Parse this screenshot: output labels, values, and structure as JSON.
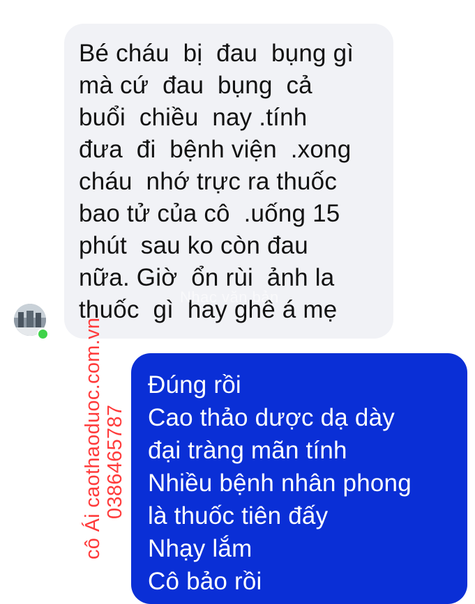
{
  "incoming_message": {
    "lines": [
      "Bé cháu  bị  đau  bụng gì",
      "mà cứ  đau  bụng  cả",
      "buổi  chiều  nay .tính",
      "đưa  đi  bệnh viện  .xong",
      "cháu  nhớ trực ra thuốc",
      "bao tử của cô  .uống 15",
      "phút  sau ko còn đau",
      "nữa. Giờ  ổn rùi  ảnh la",
      "thuốc  gì  hay ghê á mẹ"
    ]
  },
  "outgoing_message": {
    "lines": [
      "Đúng rồi",
      "Cao thảo dược dạ dày",
      "đại tràng mãn tính",
      "Nhiều bệnh nhân phong",
      "là thuốc tiên đấy",
      "Nhạy lắm",
      "Cô bảo rồi"
    ]
  },
  "watermark": {
    "line1": "cô Ái caothaoduoc.com.vn",
    "line2": "0386465787",
    "faint_text": "Nhạc văn bản"
  },
  "colors": {
    "incoming_bubble": "#f1f2f6",
    "outgoing_bubble": "#0a2fd6",
    "watermark_text": "#ff3b3b",
    "online_status": "#3fd34a"
  }
}
